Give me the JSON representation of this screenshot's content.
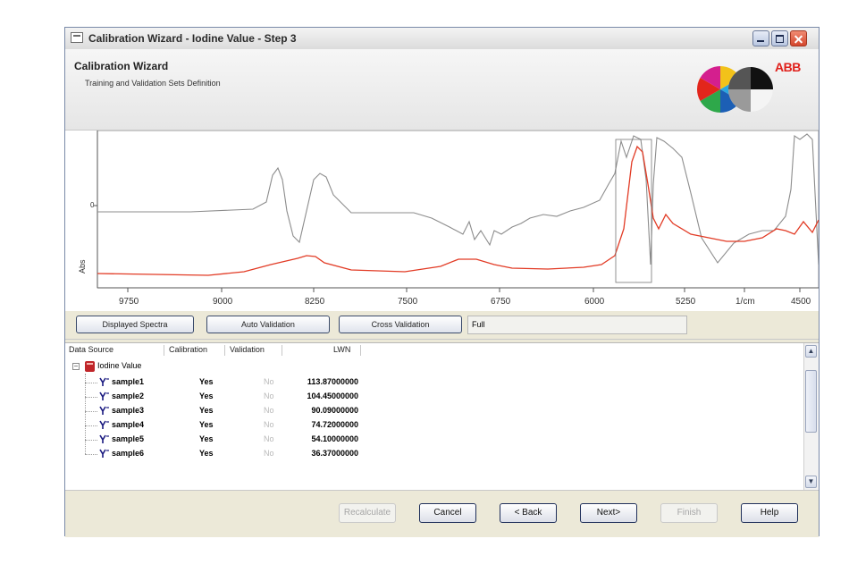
{
  "window": {
    "title": "Calibration Wizard - Iodine Value - Step 3"
  },
  "header": {
    "title": "Calibration Wizard",
    "subtitle": "Training and Validation Sets Definition",
    "brand": "ABB"
  },
  "plot": {
    "y_label": "Abs",
    "x_ticks": [
      "9750",
      "9000",
      "8250",
      "7500",
      "6750",
      "6000",
      "5250",
      "1/cm",
      "4500"
    ],
    "colors": {
      "gray_spectrum": "#8c8c8c",
      "red_spectrum": "#e23b25"
    }
  },
  "buttons": {
    "displayed_spectra": "Displayed Spectra",
    "auto_validation": "Auto Validation",
    "cross_validation": "Cross Validation",
    "range_value": "Full"
  },
  "table": {
    "columns": [
      "Data Source",
      "Calibration",
      "Validation",
      "LWN"
    ],
    "group": "Iodine Value",
    "rows": [
      {
        "name": "sample1",
        "calibration": "Yes",
        "validation": "No",
        "value": "113.87000000"
      },
      {
        "name": "sample2",
        "calibration": "Yes",
        "validation": "No",
        "value": "104.45000000"
      },
      {
        "name": "sample3",
        "calibration": "Yes",
        "validation": "No",
        "value": "90.09000000"
      },
      {
        "name": "sample4",
        "calibration": "Yes",
        "validation": "No",
        "value": "74.72000000"
      },
      {
        "name": "sample5",
        "calibration": "Yes",
        "validation": "No",
        "value": "54.10000000"
      },
      {
        "name": "sample6",
        "calibration": "Yes",
        "validation": "No",
        "value": "36.37000000"
      }
    ]
  },
  "footer": {
    "recalculate": "Recalculate",
    "cancel": "Cancel",
    "back": "< Back",
    "next": "Next>",
    "finish": "Finish",
    "help": "Help"
  }
}
